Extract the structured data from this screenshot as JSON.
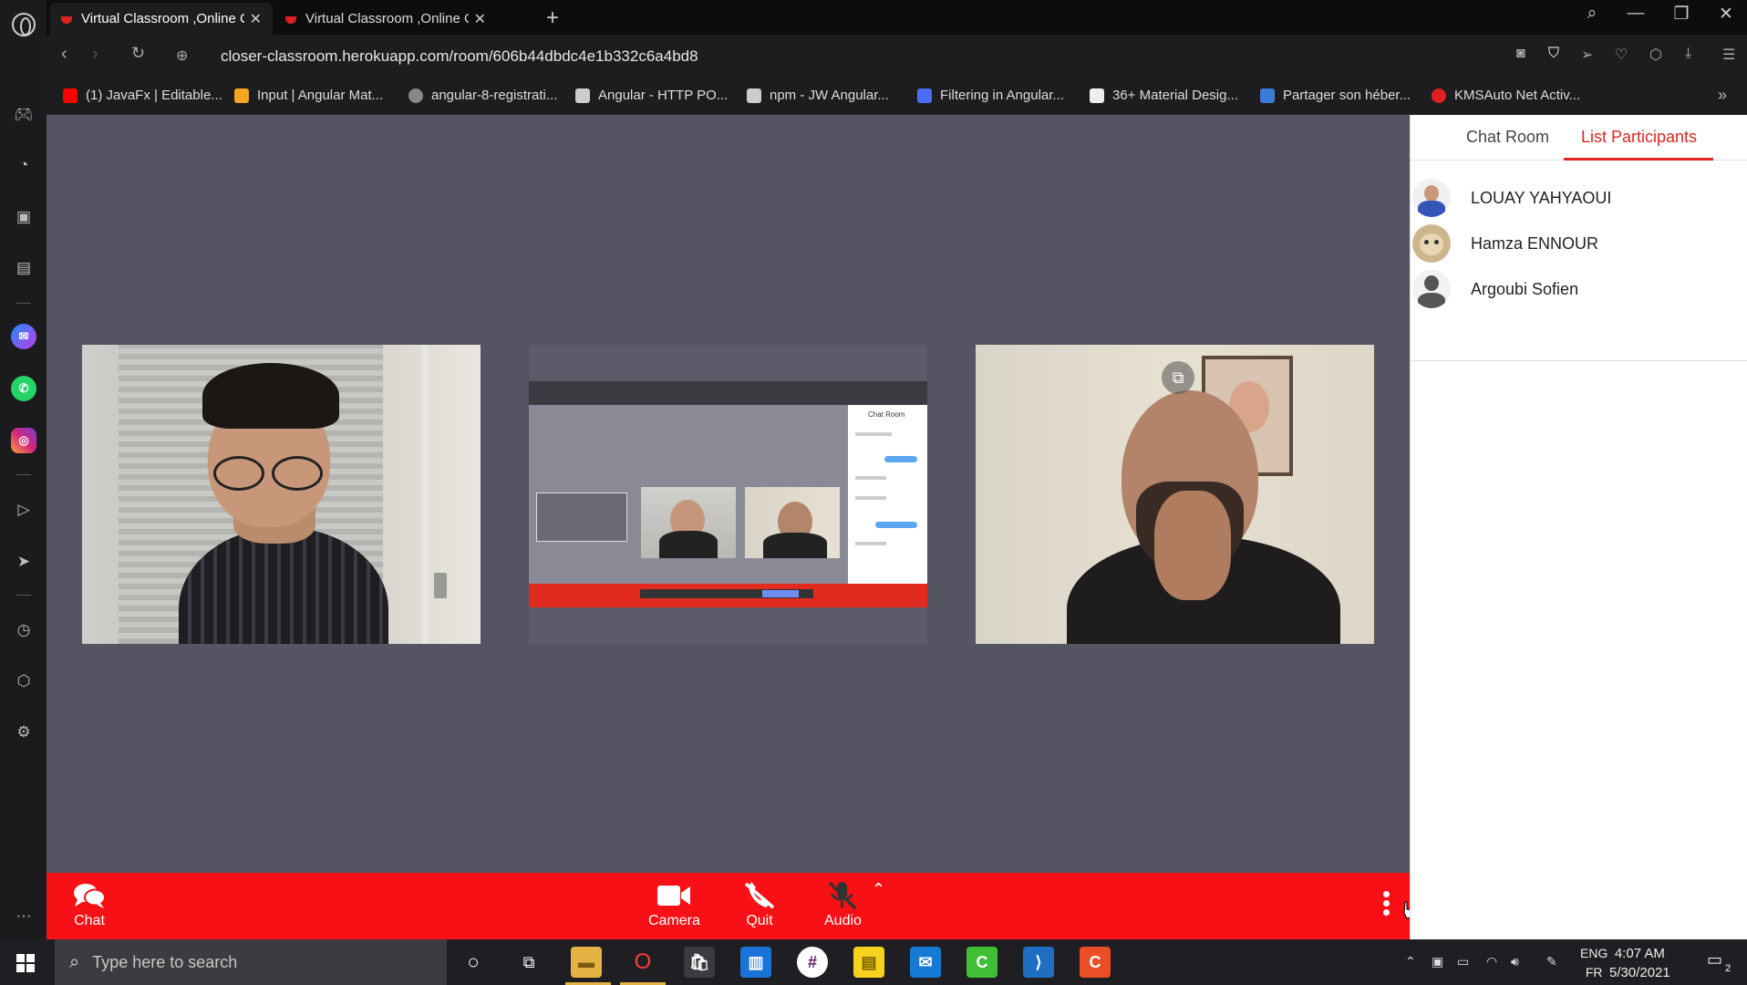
{
  "browser": {
    "tabs": [
      {
        "title": "Virtual Classroom ,Online C",
        "active": true
      },
      {
        "title": "Virtual Classroom ,Online C",
        "active": false
      }
    ],
    "url": "closer-classroom.herokuapp.com/room/606b44dbdc4e1b332c6a4bd8",
    "bookmarks": [
      {
        "label": "(1) JavaFx | Editable...",
        "color": "#ff0000"
      },
      {
        "label": "Input | Angular Mat...",
        "color": "#f5a623"
      },
      {
        "label": "angular-8-registrati...",
        "color": "#888888"
      },
      {
        "label": "Angular - HTTP PO...",
        "color": "#cccccc"
      },
      {
        "label": "npm - JW Angular...",
        "color": "#cccccc"
      },
      {
        "label": "Filtering in Angular...",
        "color": "#4a6cf7"
      },
      {
        "label": "36+ Material Desig...",
        "color": "#eeeeee"
      },
      {
        "label": "Partager son héber...",
        "color": "#3a7bd5"
      },
      {
        "label": "KMSAuto Net Activ...",
        "color": "#e02020"
      }
    ]
  },
  "panel": {
    "tabs": [
      {
        "label": "Chat Room",
        "active": false
      },
      {
        "label": "List Participants",
        "active": true
      }
    ],
    "participants": [
      {
        "name": "LOUAY YAHYAOUI"
      },
      {
        "name": "Hamza ENNOUR"
      },
      {
        "name": "Argoubi Sofien"
      }
    ]
  },
  "shared_screen": {
    "panel_title": "Chat Room"
  },
  "controls": {
    "chat_label": "Chat",
    "camera_label": "Camera",
    "quit_label": "Quit",
    "audio_label": "Audio"
  },
  "taskbar": {
    "search_placeholder": "Type here to search",
    "lang_top": "ENG",
    "lang_bottom": "FR",
    "time": "4:07 AM",
    "date": "5/30/2021",
    "notification_count": "2"
  },
  "colors": {
    "accent": "#e02424",
    "control_bar": "#f71015",
    "stage_bg": "#545462"
  }
}
